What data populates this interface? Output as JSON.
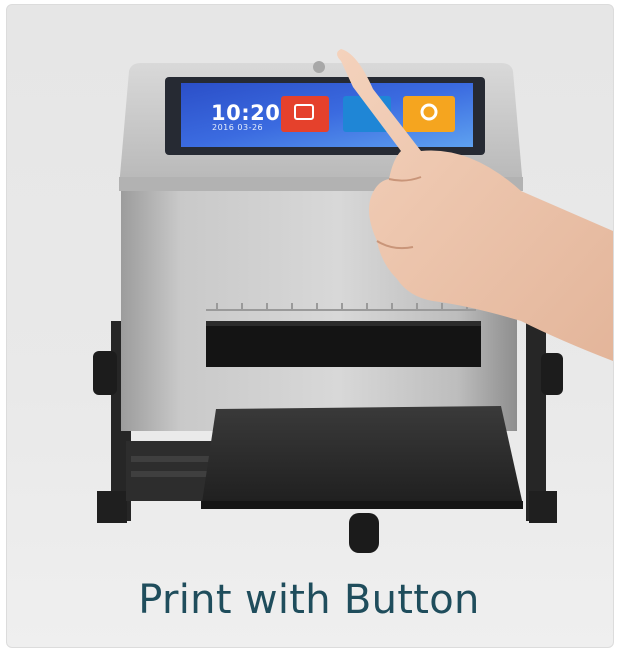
{
  "screen": {
    "time": "10:20",
    "date": "2016 03-26",
    "tiles": [
      {
        "color": "#e5412c",
        "icon": "edit-icon"
      },
      {
        "color": "#1f86d6",
        "icon": "list-icon"
      },
      {
        "color": "#f5a51f",
        "icon": "gear-icon"
      }
    ]
  },
  "caption": "Print with Button"
}
